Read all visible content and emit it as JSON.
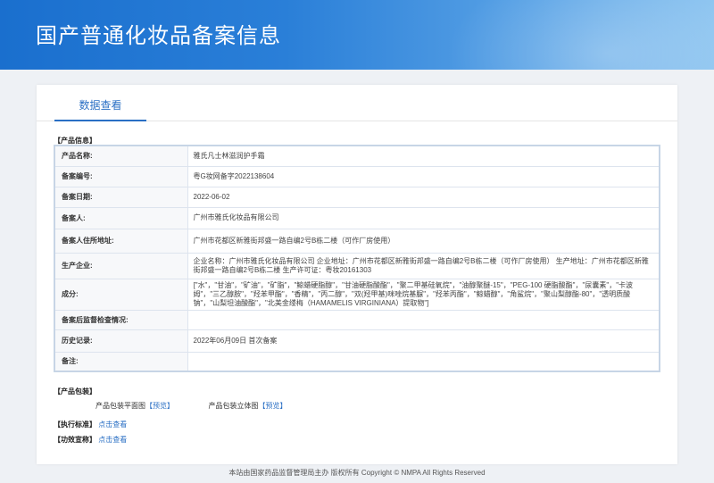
{
  "header": {
    "title": "国产普通化妆品备案信息"
  },
  "tabs": [
    {
      "label": "数据查看"
    }
  ],
  "product_info": {
    "section_title": "【产品信息】",
    "rows": [
      {
        "label": "产品名称:",
        "value": "雅氏凡士林滋润护手霜"
      },
      {
        "label": "备案编号:",
        "value": "粤G妆网备字2022138604"
      },
      {
        "label": "备案日期:",
        "value": "2022-06-02"
      },
      {
        "label": "备案人:",
        "value": "广州市雅氏化妆品有限公司"
      },
      {
        "label": "备案人住所地址:",
        "value": "广州市花都区新雅街邦盛一路自编2号B栋二楼（可作厂房使用）"
      },
      {
        "label": "生产企业:",
        "value": "企业名称：广州市雅氏化妆品有限公司 企业地址：广州市花都区新雅街邦盛一路自编2号B栋二楼（可作厂房使用） 生产地址：广州市花都区新雅街邦盛一路自编2号B栋二楼 生产许可证：粤妆20161303"
      },
      {
        "label": "成分:",
        "value": "[\"水\"，\"甘油\"，\"矿油\"，\"矿脂\"，\"鲸蜡硬脂醇\"，\"甘油硬脂酸酯\"，\"聚二甲基硅氧烷\"，\"油醇聚醚-15\"，\"PEG-100 硬脂酸酯\"，\"尿囊素\"，\"卡波姆\"，\"三乙醇胺\"，\"羟苯甲酯\"，\"香精\"，\"丙二醇\"，\"双(羟甲基)咪唑烷基脲\"，\"羟苯丙酯\"，\"鲸蜡醇\"，\"角鲨烷\"，\"聚山梨醇酯-80\"，\"透明质酸钠\"，\"山梨坦油酸酯\"，\"北美金缕梅（HAMAMELIS VIRGINIANA）提取物\"]"
      },
      {
        "label": "备案后监督检查情况:",
        "value": ""
      },
      {
        "label": "历史记录:",
        "value": "2022年06月09日 首次备案"
      },
      {
        "label": "备注:",
        "value": ""
      }
    ]
  },
  "packaging": {
    "section_title": "【产品包装】",
    "flat_label": "产品包装平面图",
    "flat_link": "【预览】",
    "solid_label": "产品包装立体图",
    "solid_link": "【预览】"
  },
  "standard": {
    "section_title": "【执行标准】",
    "link": "点击查看"
  },
  "efficacy": {
    "section_title": "【功效宣称】",
    "link": "点击查看"
  },
  "footer": {
    "text": "本站由国家药品监督管理局主办 版权所有 Copyright © NMPA All Rights Reserved"
  }
}
